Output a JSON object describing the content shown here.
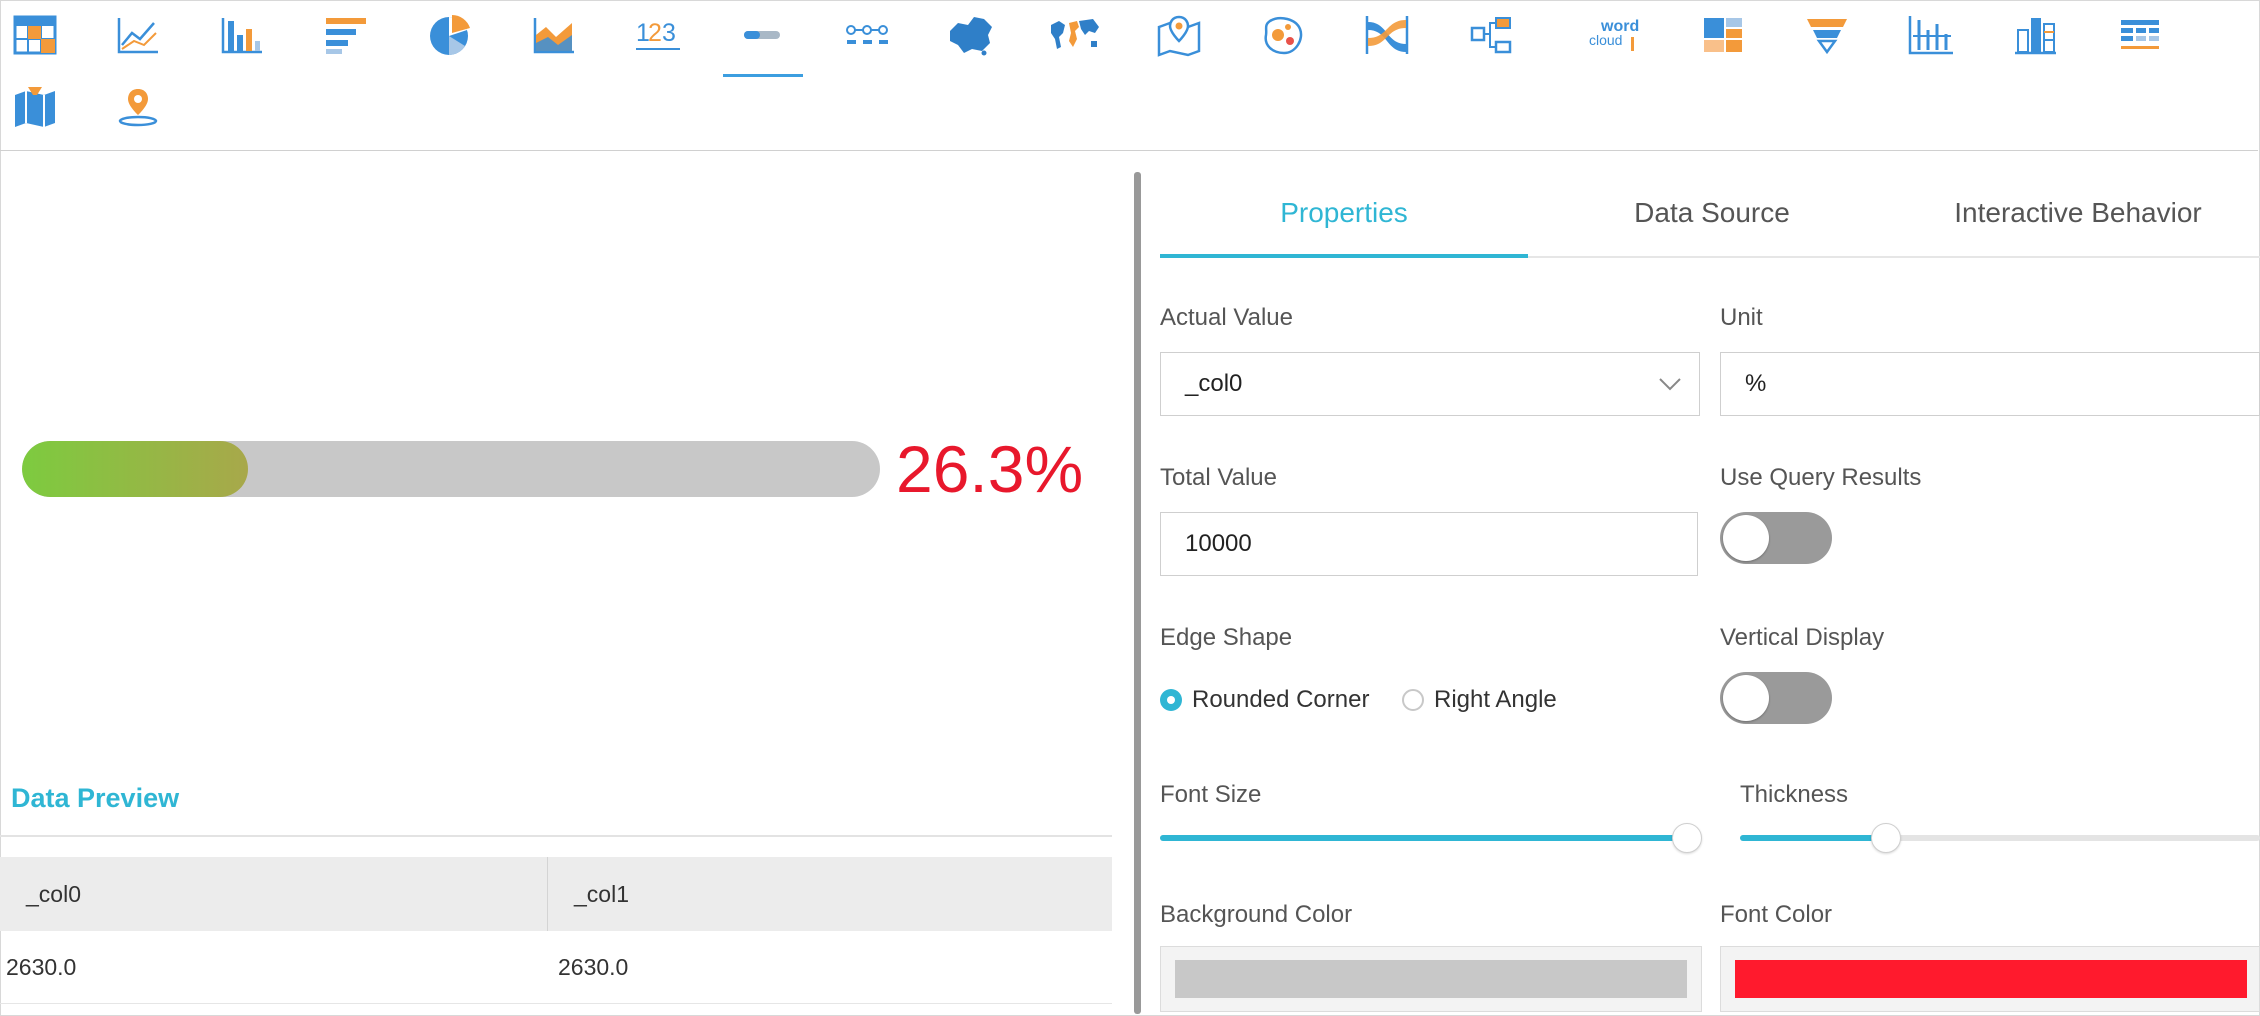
{
  "toolbar": {
    "icons": [
      {
        "name": "table-chart-icon"
      },
      {
        "name": "line-chart-icon"
      },
      {
        "name": "bar-chart-icon"
      },
      {
        "name": "horizontal-bar-chart-icon"
      },
      {
        "name": "pie-chart-icon"
      },
      {
        "name": "area-chart-icon"
      },
      {
        "name": "kpi-number-icon",
        "text": "123"
      },
      {
        "name": "progress-bar-icon",
        "active": true
      },
      {
        "name": "steps-icon"
      },
      {
        "name": "china-map-icon"
      },
      {
        "name": "world-map-icon"
      },
      {
        "name": "pin-map-icon"
      },
      {
        "name": "bubble-map-icon"
      },
      {
        "name": "sankey-chart-icon"
      },
      {
        "name": "flow-diagram-icon"
      },
      {
        "name": "word-cloud-icon",
        "text1": "word",
        "text2": "cloud"
      },
      {
        "name": "treemap-icon"
      },
      {
        "name": "funnel-chart-icon"
      },
      {
        "name": "waterfall-chart-icon"
      },
      {
        "name": "stacked-column-icon"
      },
      {
        "name": "cross-table-icon"
      },
      {
        "name": "region-map-icon"
      },
      {
        "name": "location-map-icon"
      }
    ]
  },
  "preview": {
    "progress": {
      "fraction": 0.263,
      "label": "26.3%"
    },
    "title": "Data Preview",
    "columns": [
      "_col0",
      "_col1"
    ],
    "rows": [
      [
        "2630.0",
        "2630.0"
      ]
    ]
  },
  "panel": {
    "tabs": [
      "Properties",
      "Data Source",
      "Interactive Behavior"
    ],
    "active_tab": 0,
    "actual_value": {
      "label": "Actual Value",
      "value": "_col0"
    },
    "unit": {
      "label": "Unit",
      "value": "%"
    },
    "total_value": {
      "label": "Total Value",
      "value": "10000"
    },
    "use_query_results": {
      "label": "Use Query Results",
      "on": false
    },
    "edge_shape": {
      "label": "Edge Shape",
      "options": [
        "Rounded Corner",
        "Right Angle"
      ],
      "selected": 0
    },
    "vertical_display": {
      "label": "Vertical Display",
      "on": false
    },
    "font_size": {
      "label": "Font Size",
      "fraction": 1.0
    },
    "thickness": {
      "label": "Thickness",
      "fraction": 0.28
    },
    "background_color": {
      "label": "Background Color",
      "value": "#c8c8c8"
    },
    "font_color": {
      "label": "Font Color",
      "value": "#ff1a2d"
    }
  },
  "colors": {
    "accent": "#2fb6d4",
    "progress_start": "#7dcb3f",
    "progress_end": "#a8a84a",
    "value_text": "#e8182c"
  }
}
